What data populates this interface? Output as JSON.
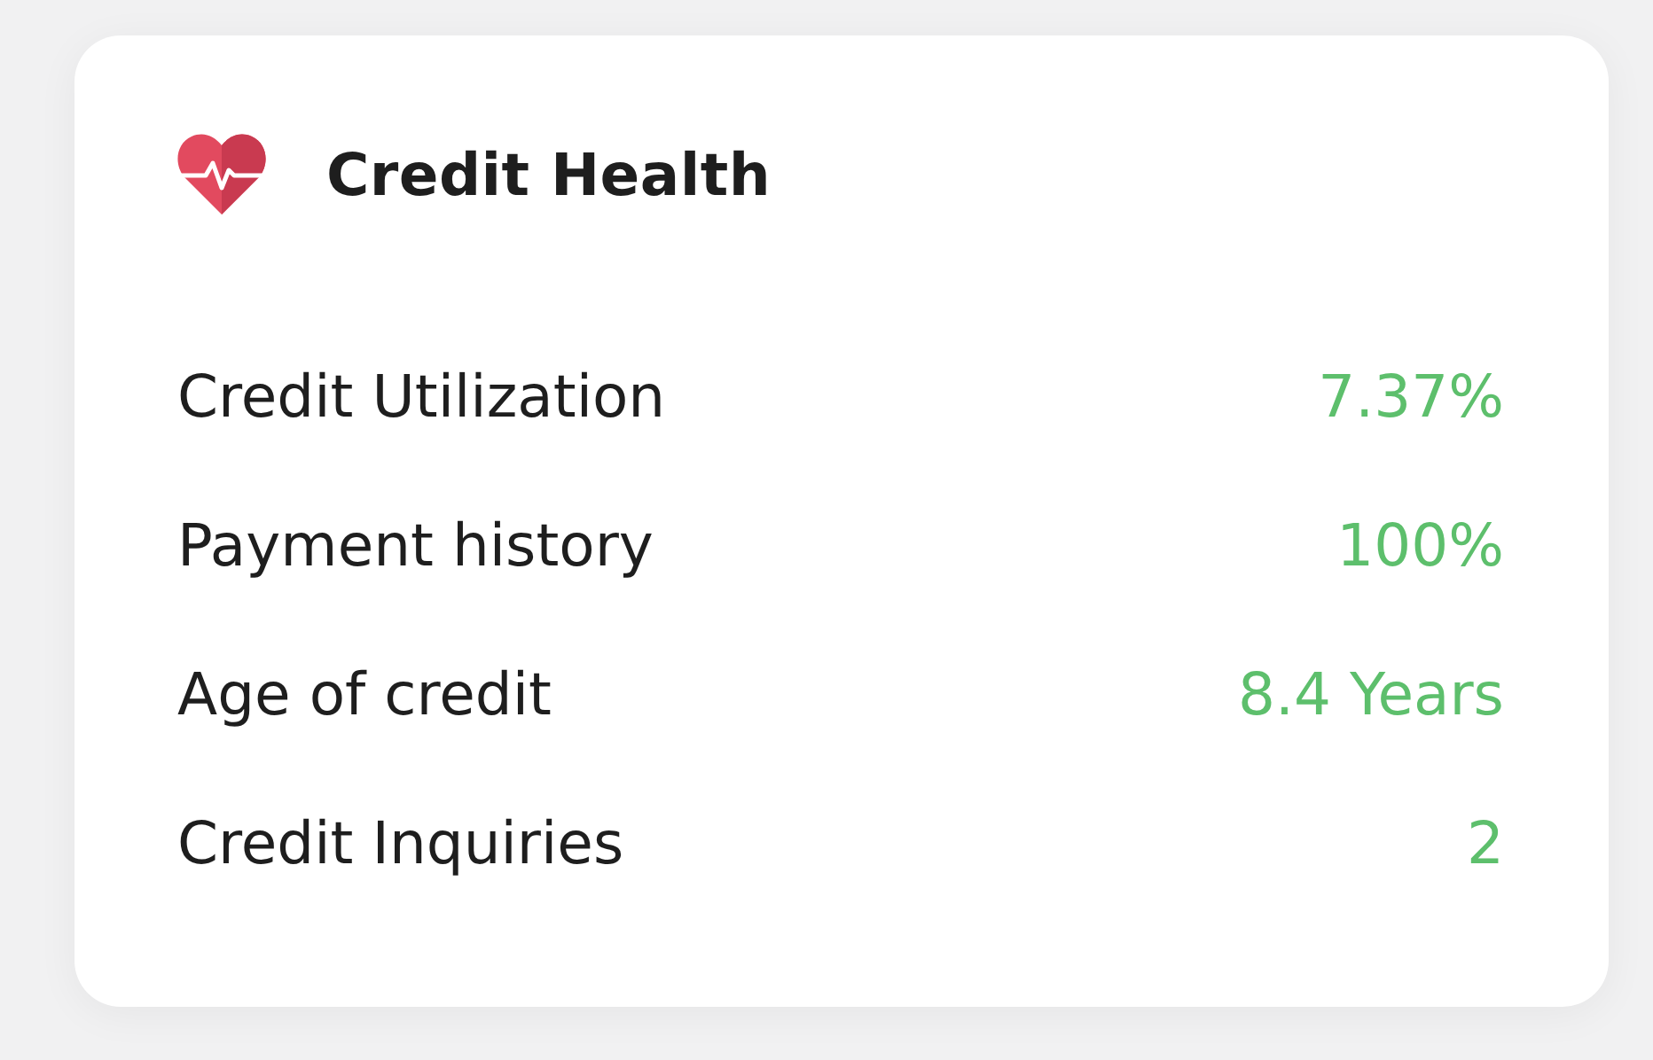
{
  "card": {
    "title": "Credit Health",
    "rows": [
      {
        "label": "Credit Utilization",
        "value": "7.37%"
      },
      {
        "label": "Payment history",
        "value": "100%"
      },
      {
        "label": "Age of credit",
        "value": "8.4 Years"
      },
      {
        "label": "Credit Inquiries",
        "value": "2"
      }
    ]
  }
}
